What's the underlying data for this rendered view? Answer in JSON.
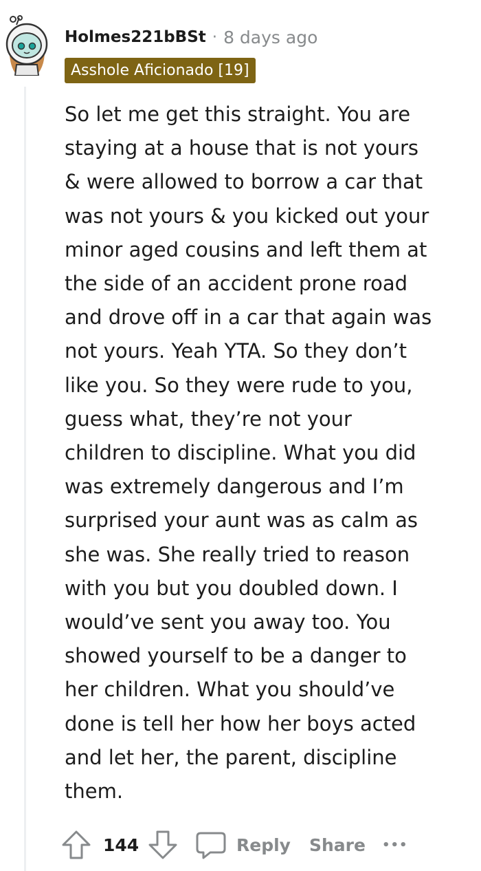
{
  "comment": {
    "author": "Holmes221bBSt",
    "separator": "·",
    "timestamp": "8 days ago",
    "flair": "Asshole Aficionado [19]",
    "body_lines": [
      "So let me get this straight. You are",
      "staying at a house that is not yours",
      "& were allowed to borrow a car that",
      "was not yours & you kicked out your",
      "minor aged cousins and left them at",
      "the side of an accident prone road",
      "and drove off in a car that again was",
      "not yours. Yeah YTA. So they don’t",
      "like you. So they were rude to you,",
      "guess what, they’re not your",
      "children to discipline. What you did",
      "was extremely dangerous and I’m",
      "surprised your aunt was as calm as",
      "she was. She really tried to reason",
      "with you but you doubled down. I",
      "would’ve sent you away too. You",
      "showed yourself to be a danger to",
      "her children. What you should’ve",
      "done is tell her how her boys acted",
      "and let her, the parent, discipline",
      "them."
    ]
  },
  "actions": {
    "score": "144",
    "reply_label": "Reply",
    "share_label": "Share",
    "more_label": "•••"
  },
  "icons": {
    "avatar": "avatar-icon",
    "upvote": "upvote-arrow-icon",
    "downvote": "downvote-arrow-icon",
    "reply": "speech-bubble-icon",
    "more": "more-options-icon"
  },
  "colors": {
    "flair_background": "#7e6414",
    "muted_text": "#878a8c",
    "thread_line": "#edeff1",
    "body_text": "#1c1c1c"
  }
}
